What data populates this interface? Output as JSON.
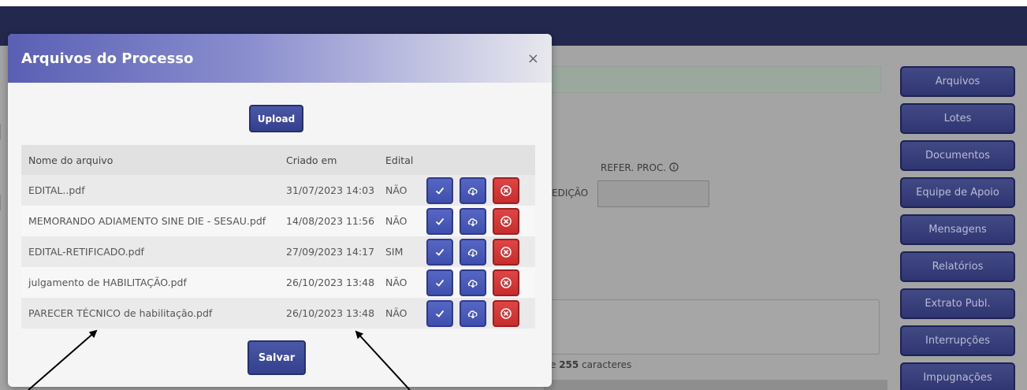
{
  "background": {
    "refer_proc_label": "REFER. PROC.",
    "edicao_label": "EDIÇÃO",
    "char_limit_prefix": "e ",
    "char_limit_number": "255",
    "char_limit_suffix": " caracteres"
  },
  "sidebar": {
    "items": [
      {
        "label": "Arquivos"
      },
      {
        "label": "Lotes"
      },
      {
        "label": "Documentos"
      },
      {
        "label": "Equipe de Apoio"
      },
      {
        "label": "Mensagens"
      },
      {
        "label": "Relatórios"
      },
      {
        "label": "Extrato Publ."
      },
      {
        "label": "Interrupções"
      },
      {
        "label": "Impugnações"
      }
    ]
  },
  "modal": {
    "title": "Arquivos do Processo",
    "close_glyph": "×",
    "upload_label": "Upload",
    "save_label": "Salvar",
    "columns": [
      "Nome do arquivo",
      "Criado em",
      "Edital"
    ],
    "rows": [
      {
        "name": "EDITAL..pdf",
        "created": "31/07/2023 14:03",
        "edital": "NÃO"
      },
      {
        "name": "MEMORANDO ADIAMENTO SINE DIE - SESAU.pdf",
        "created": "14/08/2023 11:56",
        "edital": "NÃO"
      },
      {
        "name": "EDITAL-RETIFICADO.pdf",
        "created": "27/09/2023 14:17",
        "edital": "SIM"
      },
      {
        "name": "julgamento de HABILITAÇÃO.pdf",
        "created": "26/10/2023 13:48",
        "edital": "NÃO"
      },
      {
        "name": "PARECER TÉCNICO de habilitação.pdf",
        "created": "26/10/2023 13:48",
        "edital": "NÃO"
      }
    ]
  },
  "icons": {
    "confirm": "check-icon",
    "download": "cloud-download-icon",
    "delete": "close-circle-icon",
    "info": "info-icon"
  },
  "colors": {
    "topbar": "#23284f",
    "primary_button": "#3f4fae",
    "danger_button": "#c82d2d"
  }
}
